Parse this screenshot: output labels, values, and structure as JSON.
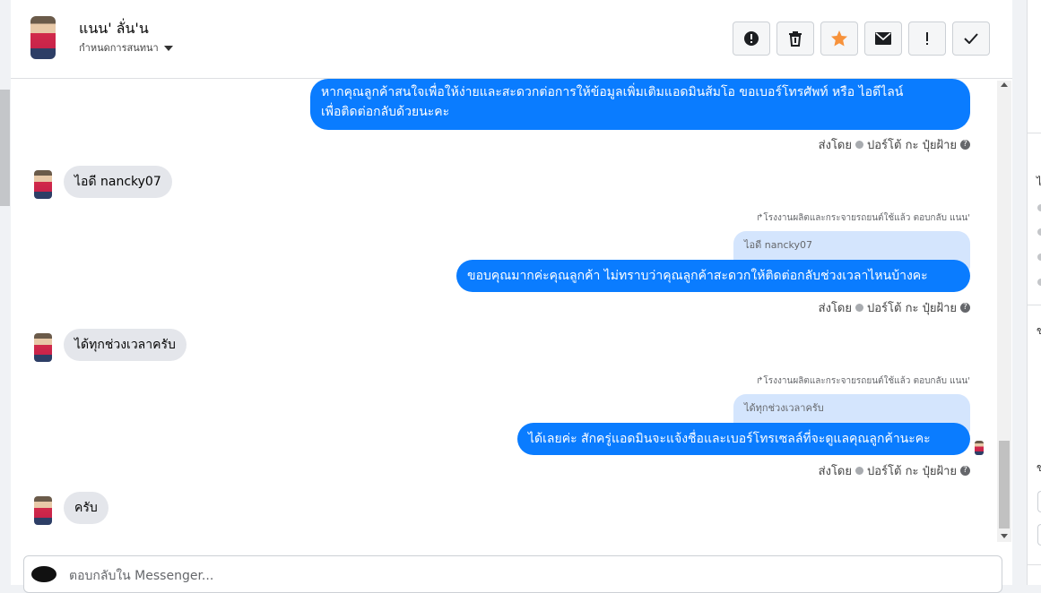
{
  "header": {
    "user_name": "แนน' ลั่น'น",
    "assign_label": "กำหนดการสนทนา",
    "toolbar": [
      {
        "name": "spam-button",
        "icon": "alert-circle-icon",
        "active": false
      },
      {
        "name": "delete-button",
        "icon": "trash-icon",
        "active": false
      },
      {
        "name": "star-button",
        "icon": "star-icon",
        "active": true
      },
      {
        "name": "mark-unread-button",
        "icon": "envelope-icon",
        "active": false
      },
      {
        "name": "follow-up-button",
        "icon": "exclamation-icon",
        "active": false
      },
      {
        "name": "done-button",
        "icon": "check-icon",
        "active": false
      }
    ]
  },
  "messages": [
    {
      "id": "m1",
      "direction": "outgoing",
      "text_line1": "หากคุณลูกค้าสนใจเพื่อให้ง่ายและสะดวกต่อการให้ข้อมูลเพิ่มเติมแอดมินส้มโอ ขอเบอร์โทรศัพท์ หรือ ไอดีไลน์",
      "text_line2": "เพื่อติดต่อกลับด้วยนะคะ",
      "sent_by_prefix": "ส่งโดย",
      "sender_name": "ปอร์โต้ กะ ปุ๋ยฝ้าย"
    },
    {
      "id": "m2",
      "direction": "incoming",
      "text": "ไอดี nancky07"
    },
    {
      "id": "m3",
      "direction": "outgoing",
      "reply_note": "โรงงานผลิตและกระจายรถยนต์ใช้แล้ว ตอบกลับ แนน'",
      "quoted_text": "ไอดี nancky07",
      "text": "ขอบคุณมากค่ะคุณลูกค้า ไม่ทราบว่าคุณลูกค้าสะดวกให้ติดต่อกลับช่วงเวลาไหนบ้างคะ",
      "sent_by_prefix": "ส่งโดย",
      "sender_name": "ปอร์โต้ กะ ปุ๋ยฝ้าย"
    },
    {
      "id": "m4",
      "direction": "incoming",
      "text": "ได้ทุกช่วงเวลาครับ"
    },
    {
      "id": "m5",
      "direction": "outgoing",
      "reply_note": "โรงงานผลิตและกระจายรถยนต์ใช้แล้ว ตอบกลับ แนน'",
      "quoted_text": "ได้ทุกช่วงเวลาครับ",
      "text": "ได้เลยค่ะ สักครู่แอดมินจะแจ้งชื่อและเบอร์โทรเซลล์ที่จะดูแลคุณลูกค้านะคะ",
      "sent_by_prefix": "ส่งโดย",
      "sender_name": "ปอร์โต้ กะ ปุ๋ยฝ้าย",
      "seen": true
    },
    {
      "id": "m6",
      "direction": "incoming",
      "text": "ครับ"
    }
  ],
  "composer": {
    "placeholder": "ตอบกลับใน Messenger..."
  },
  "colors": {
    "outgoing_bubble": "#0a7cff",
    "incoming_bubble": "#e4e6eb",
    "quote_bubble": "#d4e5fd",
    "star_active": "#f7923b"
  }
}
